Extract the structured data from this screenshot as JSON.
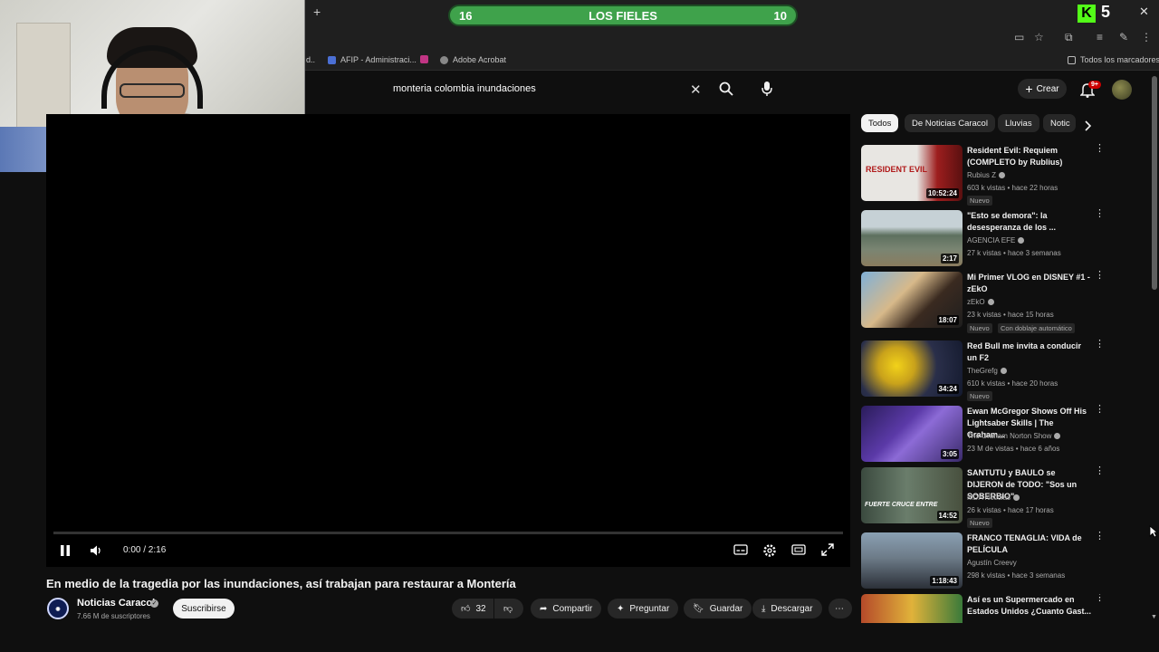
{
  "browser": {
    "new_tab": "+",
    "score_left": "16",
    "score_title": "LOS FIELES",
    "score_right": "10",
    "ext_count": "5",
    "bookmarks": [
      {
        "label": "AFIP - Administraci...",
        "color": "#4b6fd4"
      },
      {
        "label": "",
        "color": "#c13584"
      },
      {
        "label": "Adobe Acrobat",
        "color": "#888888"
      }
    ],
    "all_bookmarks": "Todos los marcadores"
  },
  "search": {
    "query": "monteria colombia inundaciones"
  },
  "masthead": {
    "create_label": "Crear",
    "notif_badge": "9+"
  },
  "player": {
    "time": "0:00 / 2:16",
    "progress": 0.0
  },
  "video": {
    "title": "En medio de la tragedia por las inundaciones, así trabajan para restaurar a Montería",
    "channel": "Noticias Caracol",
    "subs": "7.66 M de suscriptores",
    "subscribe": "Suscribirse",
    "likes": "32",
    "share": "Compartir",
    "ask": "Preguntar",
    "save": "Guardar",
    "download": "Descargar"
  },
  "chips": [
    "Todos",
    "De Noticias Caracol",
    "Lluvias",
    "Notic"
  ],
  "recommendations": [
    {
      "title": "Resident Evil: Requiem (COMPLETO by Rublius)",
      "channel": "Rubius Z",
      "views": "603 k vistas • hace 22 horas",
      "badge": "Nuevo",
      "duration": "10:52:24",
      "thumb": "#9d1e1e"
    },
    {
      "title": "\"Esto se demora\": la desesperanza de los ...",
      "channel": "AGENCIA EFE",
      "views": "27 k vistas • hace 3 semanas",
      "badge": "",
      "duration": "2:17",
      "thumb": "#6b7f78"
    },
    {
      "title": "Mi Primer VLOG en DISNEY #1 - zEkO",
      "channel": "zEkO",
      "views": "23 k vistas • hace 15 horas",
      "badge": "Nuevo",
      "badge2": "Con doblaje automático",
      "duration": "18:07",
      "thumb": "#3d6f9e"
    },
    {
      "title": "Red Bull me invita a conducir un F2",
      "channel": "TheGrefg",
      "views": "610 k vistas • hace 20 horas",
      "badge": "Nuevo",
      "duration": "34:24",
      "thumb": "#c9a21b"
    },
    {
      "title": "Ewan McGregor Shows Off His Lightsaber Skills | The Graham...",
      "channel": "The Graham Norton Show",
      "views": "23 M de vistas • hace 6 años",
      "badge": "",
      "duration": "3:05",
      "thumb": "#4a2f8a"
    },
    {
      "title": "SANTUTU y BAULO se DIJERON de TODO: \"Sos un SOBERBIO\"",
      "channel": "MDA Noticias",
      "views": "26 k vistas • hace 17 horas",
      "badge": "Nuevo",
      "duration": "14:52",
      "thumb": "#2e5d3c"
    },
    {
      "title": "FRANCO TENAGLIA: VIDA de PELÍCULA",
      "channel": "Agustín Creevy",
      "views": "298 k vistas • hace 3 semanas",
      "badge": "",
      "duration": "1:18:43",
      "thumb": "#6d7b88"
    },
    {
      "title": "Así es un Supermercado en Estados Unidos ¿Cuanto Gast...",
      "channel": "",
      "views": "",
      "badge": "",
      "duration": "",
      "thumb": "#b54a2a"
    }
  ]
}
